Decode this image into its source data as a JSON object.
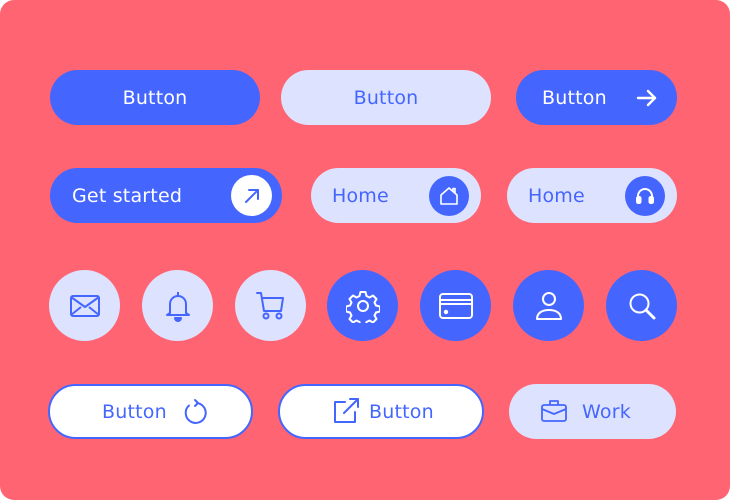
{
  "colors": {
    "background": "#FF6473",
    "primary": "#4466FF",
    "primary_light": "#DDE2FF",
    "white": "#FFFFFF"
  },
  "row1": {
    "primary_button": {
      "label": "Button"
    },
    "secondary_button": {
      "label": "Button"
    },
    "arrow_button": {
      "label": "Button",
      "icon": "arrow-right-icon"
    }
  },
  "row2": {
    "get_started_button": {
      "label": "Get started",
      "icon": "arrow-up-right-icon"
    },
    "home_button_1": {
      "label": "Home",
      "icon": "home-icon"
    },
    "home_button_2": {
      "label": "Home",
      "icon": "headphones-icon"
    }
  },
  "row3": {
    "icon_buttons": [
      {
        "icon": "mail-icon",
        "style": "light"
      },
      {
        "icon": "bell-icon",
        "style": "light"
      },
      {
        "icon": "cart-icon",
        "style": "light"
      },
      {
        "icon": "gear-icon",
        "style": "solid"
      },
      {
        "icon": "credit-card-icon",
        "style": "solid"
      },
      {
        "icon": "user-icon",
        "style": "solid"
      },
      {
        "icon": "search-icon",
        "style": "solid"
      }
    ]
  },
  "row4": {
    "refresh_button": {
      "label": "Button",
      "icon": "refresh-icon"
    },
    "external_button": {
      "label": "Button",
      "icon": "external-link-icon"
    },
    "work_button": {
      "label": "Work",
      "icon": "briefcase-icon"
    }
  }
}
